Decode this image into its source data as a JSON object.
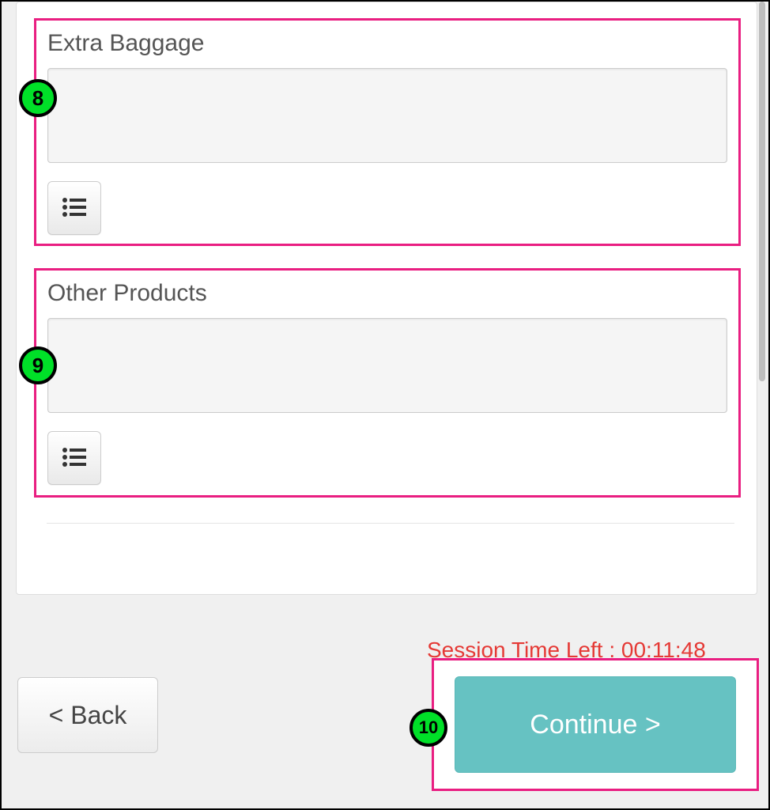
{
  "sections": {
    "extra_baggage": {
      "title": "Extra Baggage",
      "value": ""
    },
    "other_products": {
      "title": "Other Products",
      "value": ""
    }
  },
  "session": {
    "label_prefix": "Session Time Left : ",
    "time": "00:11:48"
  },
  "buttons": {
    "back": "< Back",
    "continue": "Continue >"
  },
  "annotations": {
    "a8": "8",
    "a9": "9",
    "a10": "10"
  }
}
